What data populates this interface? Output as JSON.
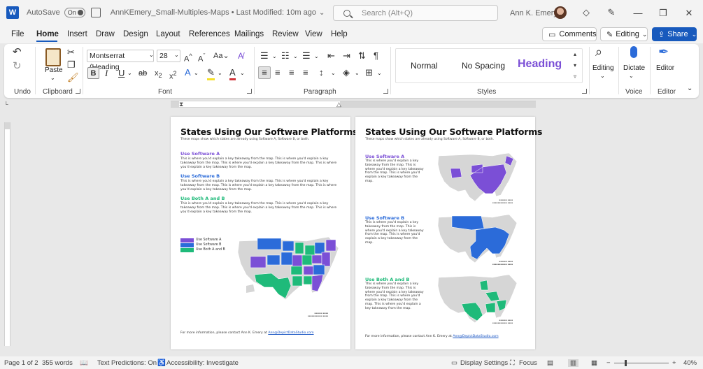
{
  "titlebar": {
    "app_letter": "W",
    "autosave_label": "AutoSave",
    "autosave_state": "On",
    "doc_title": "AnnKEmery_Small-Multiples-Maps • Last Modified: 10m ago",
    "doc_title_chevron": "⌄",
    "search_placeholder": "Search (Alt+Q)",
    "user_name": "Ann K. Emery"
  },
  "menu": {
    "tabs": [
      "File",
      "Home",
      "Insert",
      "Draw",
      "Design",
      "Layout",
      "References",
      "Mailings",
      "Review",
      "View",
      "Help"
    ],
    "active_tab": "Home",
    "comments_label": "Comments",
    "editing_label": "Editing",
    "share_label": "Share"
  },
  "ribbon": {
    "groups": {
      "undo": "Undo",
      "clipboard": "Clipboard",
      "font": "Font",
      "paragraph": "Paragraph",
      "styles": "Styles",
      "voice": "Voice",
      "editor": "Editor"
    },
    "paste_label": "Paste",
    "font_name": "Montserrat (Heading",
    "font_size": "28",
    "styles": [
      "Normal",
      "No Spacing",
      "Heading"
    ],
    "editing_label": "Editing",
    "dictate_label": "Dictate",
    "editor_label": "Editor"
  },
  "page1": {
    "title": "States Using Our Software Platforms",
    "subtitle": "These maps show which states are already using Software A, Software B, or both.",
    "sections": [
      {
        "heading": "Use Software A",
        "text": "This is where you'd explain a key takeaway from the map. This is where you'd explain a key takeaway from the map. This is where you'd explain a key takeaway from the map. This is where you'd explain a key takeaway from the map."
      },
      {
        "heading": "Use Software B",
        "text": "This is where you'd explain a key takeaway from the map. This is where you'd explain a key takeaway from the map. This is where you'd explain a key takeaway from the map. This is where you'd explain a key takeaway from the map."
      },
      {
        "heading": "Use Both A and B",
        "text": "This is where you'd explain a key takeaway from the map. This is where you'd explain a key takeaway from the map. This is where you'd explain a key takeaway from the map. This is where you'd explain a key takeaway from the map."
      }
    ],
    "legend": [
      "Use Software A",
      "Use Software B",
      "Use Both A and B"
    ],
    "footer_text": "For more information, please contact Ann K. Emery at",
    "footer_email": "Ann@DepictDataStudio.com"
  },
  "page2": {
    "title": "States Using Our Software Platforms",
    "subtitle": "These maps show which states are already using Software A, Software B, or both.",
    "sections": [
      {
        "heading": "Use Software A",
        "text": "This is where you'd explain a key takeaway from the map. This is where you'd explain a key takeaway from the map. This is where you'd explain a key takeaway from the map."
      },
      {
        "heading": "Use Software B",
        "text": "This is where you'd explain a key takeaway from the map. This is where you'd explain a key takeaway from the map. This is where you'd explain a key takeaway from the map."
      },
      {
        "heading": "Use Both A and B",
        "text": "This is where you'd explain a key takeaway from the map. This is where you'd explain a key takeaway from the map. This is where you'd explain a key takeaway from the map. This is where you'd explain a key takeaway from the map."
      }
    ],
    "footer_text": "For more information, please contact Ann K. Emery at",
    "footer_email": "Ann@DepictDataStudio.com"
  },
  "colors": {
    "software_a": "#7b4fd6",
    "software_b": "#2b6bd9",
    "both": "#1fba7a",
    "none": "#d6d6d6",
    "word_blue": "#185abd"
  },
  "status": {
    "page": "Page 1 of 2",
    "words": "355 words",
    "text_predictions": "Text Predictions: On",
    "accessibility": "Accessibility: Investigate",
    "display_settings": "Display Settings",
    "focus": "Focus",
    "zoom": "40%"
  }
}
